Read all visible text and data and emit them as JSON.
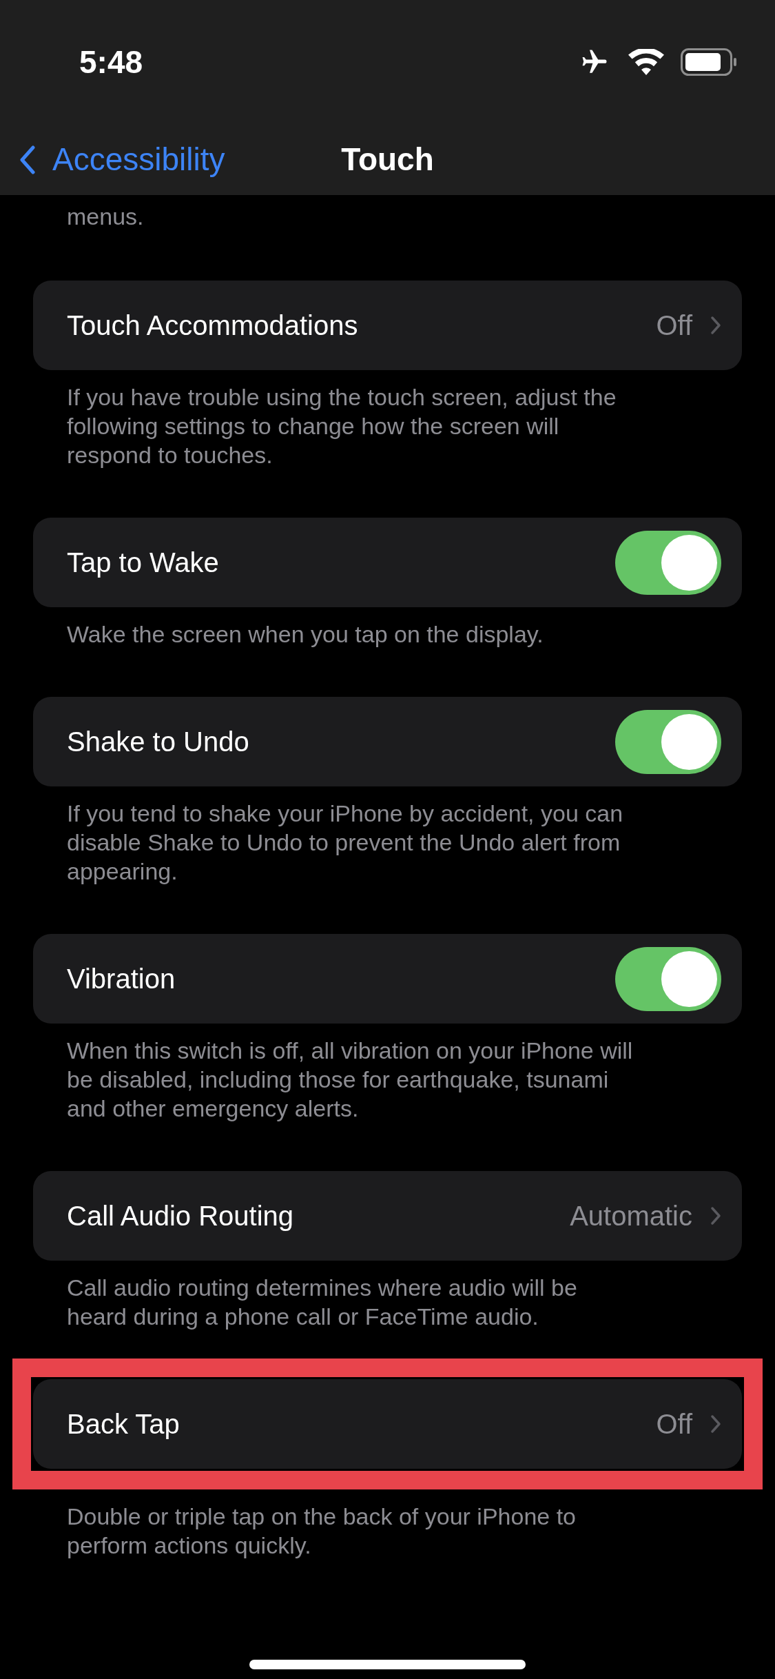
{
  "status_bar": {
    "time": "5:48"
  },
  "nav": {
    "back": "Accessibility",
    "title": "Touch"
  },
  "top_footer": "menus.",
  "rows": [
    {
      "kind": "link",
      "label": "Touch Accommodations",
      "value": "Off",
      "highlighted": false,
      "footer": [
        "If you have trouble using the touch screen, adjust the",
        "following settings to change how the screen will",
        "respond to touches."
      ]
    },
    {
      "kind": "toggle",
      "label": "Tap to Wake",
      "on": true,
      "highlighted": false,
      "footer": [
        "Wake the screen when you tap on the display."
      ]
    },
    {
      "kind": "toggle",
      "label": "Shake to Undo",
      "on": true,
      "highlighted": false,
      "footer": [
        "If you tend to shake your iPhone by accident, you can",
        "disable Shake to Undo to prevent the Undo alert from",
        "appearing."
      ]
    },
    {
      "kind": "toggle",
      "label": "Vibration",
      "on": true,
      "highlighted": false,
      "footer": [
        "When this switch is off, all vibration on your iPhone will",
        "be disabled, including those for earthquake, tsunami",
        "and other emergency alerts."
      ]
    },
    {
      "kind": "link",
      "label": "Call Audio Routing",
      "value": "Automatic",
      "highlighted": false,
      "footer": [
        "Call audio routing determines where audio will be",
        "heard during a phone call or FaceTime audio."
      ]
    },
    {
      "kind": "link",
      "label": "Back Tap",
      "value": "Off",
      "highlighted": true,
      "footer": [
        "Double or triple tap on the back of your iPhone to",
        "perform actions quickly."
      ]
    }
  ]
}
